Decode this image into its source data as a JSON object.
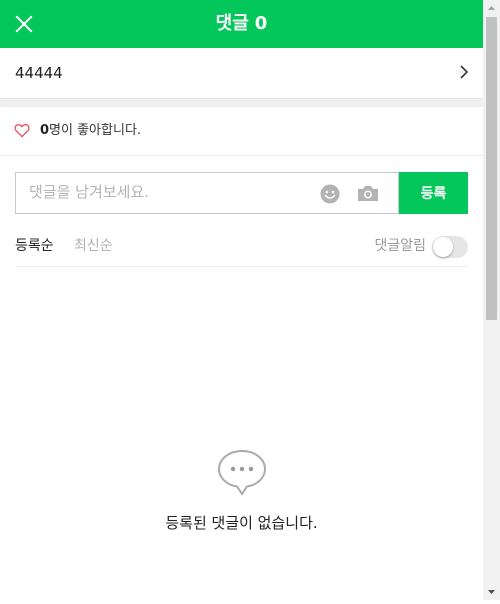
{
  "header": {
    "title": "댓글",
    "count": "0",
    "close_icon": "close-icon",
    "background": "#03c75a"
  },
  "post": {
    "title": "44444",
    "chevron_icon": "chevron-right-icon"
  },
  "likes": {
    "count": "0",
    "text": "명이 좋아합니다.",
    "icon": "heart-outline-icon",
    "heart_color": "#f0485c"
  },
  "comment_form": {
    "placeholder": "댓글을 남겨보세요.",
    "value": "",
    "emoji_icon": "emoji-icon",
    "camera_icon": "camera-icon",
    "submit_label": "등록"
  },
  "sort": {
    "active": "등록순",
    "inactive": "최신순"
  },
  "notify": {
    "label": "댓글알림",
    "enabled": false
  },
  "empty": {
    "icon": "speech-bubble-icon",
    "message": "등록된 댓글이 없습니다."
  },
  "accent_color": "#03c75a"
}
